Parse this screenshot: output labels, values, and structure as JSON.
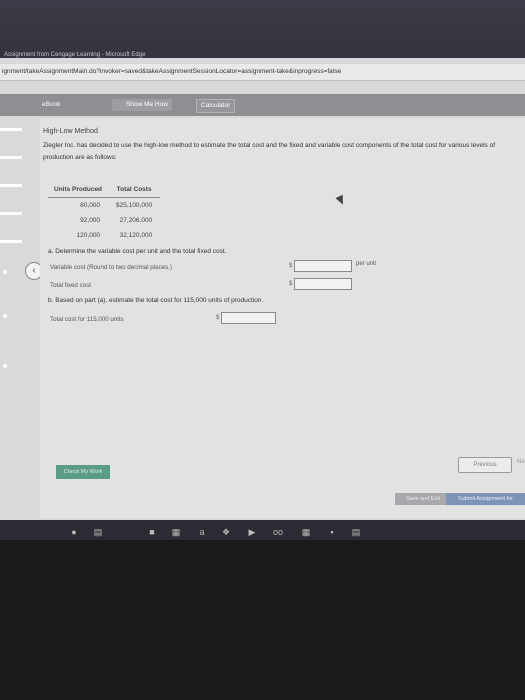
{
  "browser": {
    "title": "Assignment from Cengage Learning - Microsoft Edge",
    "url": "ignment/takeAssignmentMain.do?invoker=saved&takeAssignmentSessionLocator=assignment-take&inprogress=false"
  },
  "toolbar": {
    "ebook": "eBook",
    "show_me_how": "Show Me How",
    "calculator": "Calculator"
  },
  "problem": {
    "heading": "High-Low Method",
    "text": "Ziegler Inc. has decided to use the high-low method to estimate the total cost and the fixed and variable cost components of the total cost for various levels of production are as follows:"
  },
  "table": {
    "headers": [
      "Units Produced",
      "Total Costs"
    ],
    "rows": [
      [
        "80,000",
        "$25,100,000"
      ],
      [
        "92,000",
        "27,206,000"
      ],
      [
        "120,000",
        "32,120,000"
      ]
    ]
  },
  "part_a": {
    "prompt": "a.  Determine the variable cost per unit and the total fixed cost.",
    "variable_label": "Variable cost (Round to two decimal places.)",
    "fixed_label": "Total fixed cost",
    "dollar": "$",
    "per_unit": "per unit",
    "variable_value": "",
    "fixed_value": ""
  },
  "part_b": {
    "prompt": "b.  Based on part (a), estimate the total cost for 115,000 units of production.",
    "label": "Total cost for 115,000 units",
    "dollar": "$",
    "value": ""
  },
  "buttons": {
    "check": "Check My Work",
    "previous": "Previous",
    "next": "Ne",
    "save": "Save and Exit",
    "submit": "Submit Assignment for"
  }
}
